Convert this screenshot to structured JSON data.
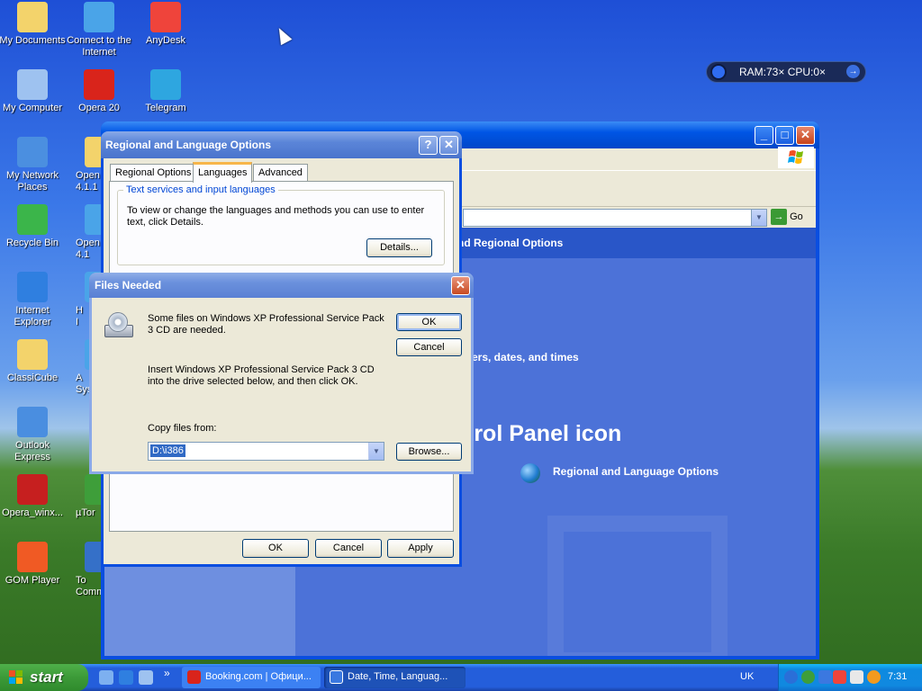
{
  "desktop": {
    "icons": [
      {
        "label": "My Documents",
        "icon": "folder-documents-icon",
        "color": "#f3d36b"
      },
      {
        "label": "Connect to the Internet",
        "icon": "globe-cursor-icon",
        "color": "#4aa4e8"
      },
      {
        "label": "AnyDesk",
        "icon": "anydesk-icon",
        "color": "#ef443b"
      },
      {
        "label": "My Computer",
        "icon": "computer-icon",
        "color": "#9ec2f0"
      },
      {
        "label": "Opera 20",
        "icon": "opera-icon",
        "color": "#d9241b"
      },
      {
        "label": "Telegram",
        "icon": "telegram-icon",
        "color": "#2ea6e0"
      },
      {
        "label": "My Network Places",
        "icon": "network-icon",
        "color": "#4b8fe0"
      },
      {
        "label": "Open",
        "sub": "4.1.1",
        "icon": "folder-icon",
        "color": "#f3d36b"
      },
      {
        "label": "Recycle Bin",
        "icon": "recycle-bin-icon",
        "color": "#3bb54a"
      },
      {
        "label": "Open",
        "sub": "4.1",
        "icon": "app-icon",
        "color": "#4aa4e8"
      },
      {
        "label": "Internet Explorer",
        "icon": "ie-icon",
        "color": "#2f7fe0"
      },
      {
        "label": "H",
        "sub": "I",
        "icon": "app-icon",
        "color": "#4aa4e8"
      },
      {
        "label": "ClassiCube",
        "icon": "folder-icon",
        "color": "#f3d36b"
      },
      {
        "label": "A",
        "sub": "Sys",
        "icon": "app-icon",
        "color": "#4aa4e8"
      },
      {
        "label": "Outlook Express",
        "icon": "outlook-icon",
        "color": "#4a8ee0"
      },
      {
        "label": "Opera_winx...",
        "icon": "opera-setup-icon",
        "color": "#c61f1f"
      },
      {
        "label": "µTor",
        "icon": "utorrent-icon",
        "color": "#3e9e3a"
      },
      {
        "label": "GOM Player",
        "icon": "gom-player-icon",
        "color": "#f05a24"
      },
      {
        "label": "To",
        "sub": "Comm",
        "icon": "app-icon",
        "color": "#3570c8"
      }
    ]
  },
  "widget": {
    "text": "RAM:73×  CPU:0×",
    "arrow": "→"
  },
  "control_panel": {
    "go_label": "Go",
    "header_text": "nd Regional Options",
    "pick_text": "ers, dates, and times",
    "big_text": "trol Panel icon",
    "link_text": "Regional and Language Options"
  },
  "regional_dialog": {
    "title": "Regional and Language Options",
    "help": "?",
    "close": "✕",
    "tabs": [
      "Regional Options",
      "Languages",
      "Advanced"
    ],
    "active_tab": "Languages",
    "group_label": "Text services and input languages",
    "group_text": "To view or change the languages and methods you can use to enter text, click Details.",
    "details_button": "Details...",
    "ok_button": "OK",
    "cancel_button": "Cancel",
    "apply_button": "Apply"
  },
  "files_needed": {
    "title": "Files Needed",
    "close": "✕",
    "message1": "Some files on Windows XP Professional Service Pack 3 CD are needed.",
    "message2": "Insert Windows XP Professional Service Pack 3 CD into the drive selected below, and then click OK.",
    "copy_label": "Copy files from:",
    "path_value": "D:\\i386",
    "ok_button": "OK",
    "cancel_button": "Cancel",
    "browse_button": "Browse..."
  },
  "taskbar": {
    "start_label": "start",
    "chevron": "»",
    "buttons": [
      {
        "label": "Booking.com | Офици...",
        "icon": "opera-icon",
        "color": "#d9241b"
      },
      {
        "label": "Date, Time, Languag...",
        "icon": "control-panel-icon",
        "color": "#3a78e0"
      }
    ],
    "language": "UK",
    "clock": "7:31"
  }
}
